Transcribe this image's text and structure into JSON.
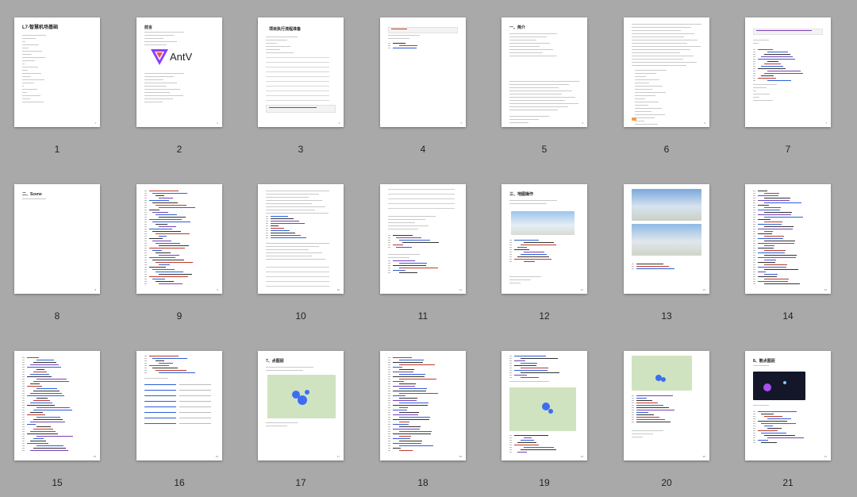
{
  "pages": [
    {
      "num": "1",
      "title": "L7-智慧机场基础"
    },
    {
      "num": "2",
      "title": "前言",
      "logo_text": "AntV"
    },
    {
      "num": "3",
      "title": "项目执行流程准备"
    },
    {
      "num": "4"
    },
    {
      "num": "5",
      "title": "一、简介"
    },
    {
      "num": "6",
      "title": ""
    },
    {
      "num": "7"
    },
    {
      "num": "8",
      "title": "二、Scene"
    },
    {
      "num": "9"
    },
    {
      "num": "10"
    },
    {
      "num": "11"
    },
    {
      "num": "12",
      "title": "三、地图操作"
    },
    {
      "num": "13"
    },
    {
      "num": "14"
    },
    {
      "num": "15"
    },
    {
      "num": "16"
    },
    {
      "num": "17",
      "title": "7、点图层"
    },
    {
      "num": "18"
    },
    {
      "num": "19"
    },
    {
      "num": "20"
    },
    {
      "num": "21",
      "title": "8、散点图层"
    }
  ],
  "colors": {
    "background": "#a9a9a9",
    "page": "#ffffff",
    "code_purple": "#7b3fb5",
    "code_blue": "#2b5fd9",
    "code_red": "#c0392b",
    "map_green": "#cfe3c1",
    "map_blue_point": "#3d6df2",
    "dark_map": "#14162a"
  }
}
